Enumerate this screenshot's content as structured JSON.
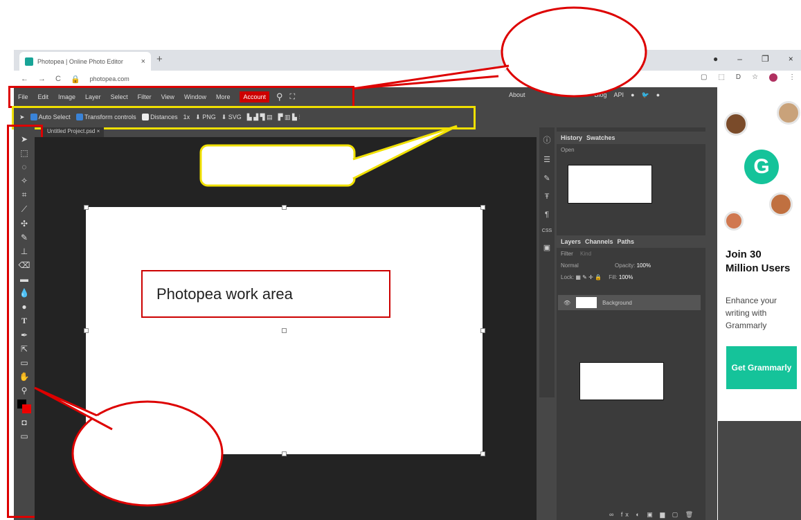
{
  "browser": {
    "tab_title": "Photopea | Online Photo Editor",
    "tab_close": "×",
    "new_tab": "+",
    "url": "photopea.com",
    "nav": [
      "←",
      "→",
      "C"
    ],
    "window_controls": [
      "●",
      "–",
      "❐",
      "×"
    ],
    "icons": [
      "▢",
      "⬚",
      "D",
      "☆",
      "⋮"
    ]
  },
  "menubar": {
    "items": [
      "File",
      "Edit",
      "Image",
      "Layer",
      "Select",
      "Filter",
      "View",
      "Window",
      "More"
    ],
    "account": "Account",
    "right": [
      "About",
      "Blog",
      "API"
    ]
  },
  "options": {
    "auto_select": "Auto Select",
    "transform_controls": "Transform controls",
    "distances": "Distances",
    "scale": "1x",
    "png": "PNG",
    "svg": "SVG"
  },
  "document": {
    "tab": "Untitled Project.psd",
    "close": "×"
  },
  "work_area_label": "Photopea work area",
  "history": {
    "tabs": [
      "History",
      "Swatches"
    ],
    "entries": [
      "Open"
    ]
  },
  "layers": {
    "tabs": [
      "Layers",
      "Channels",
      "Paths"
    ],
    "filter": "Filter",
    "kind": "Kind",
    "blend_mode": "Normal",
    "opacity_label": "Opacity:",
    "opacity": "100%",
    "lock_label": "Lock:",
    "fill_label": "Fill:",
    "fill": "100%",
    "items": [
      "Background"
    ]
  },
  "ad": {
    "headline": "Join 30 Million Users",
    "subtext": "Enhance your writing with Grammarly",
    "button": "Get Grammarly",
    "logo": "G"
  },
  "colors": {
    "app_bg": "#474747",
    "accent_red": "#cc0000",
    "annotation_yellow": "#f0e000",
    "grammarly_green": "#15c39a"
  }
}
